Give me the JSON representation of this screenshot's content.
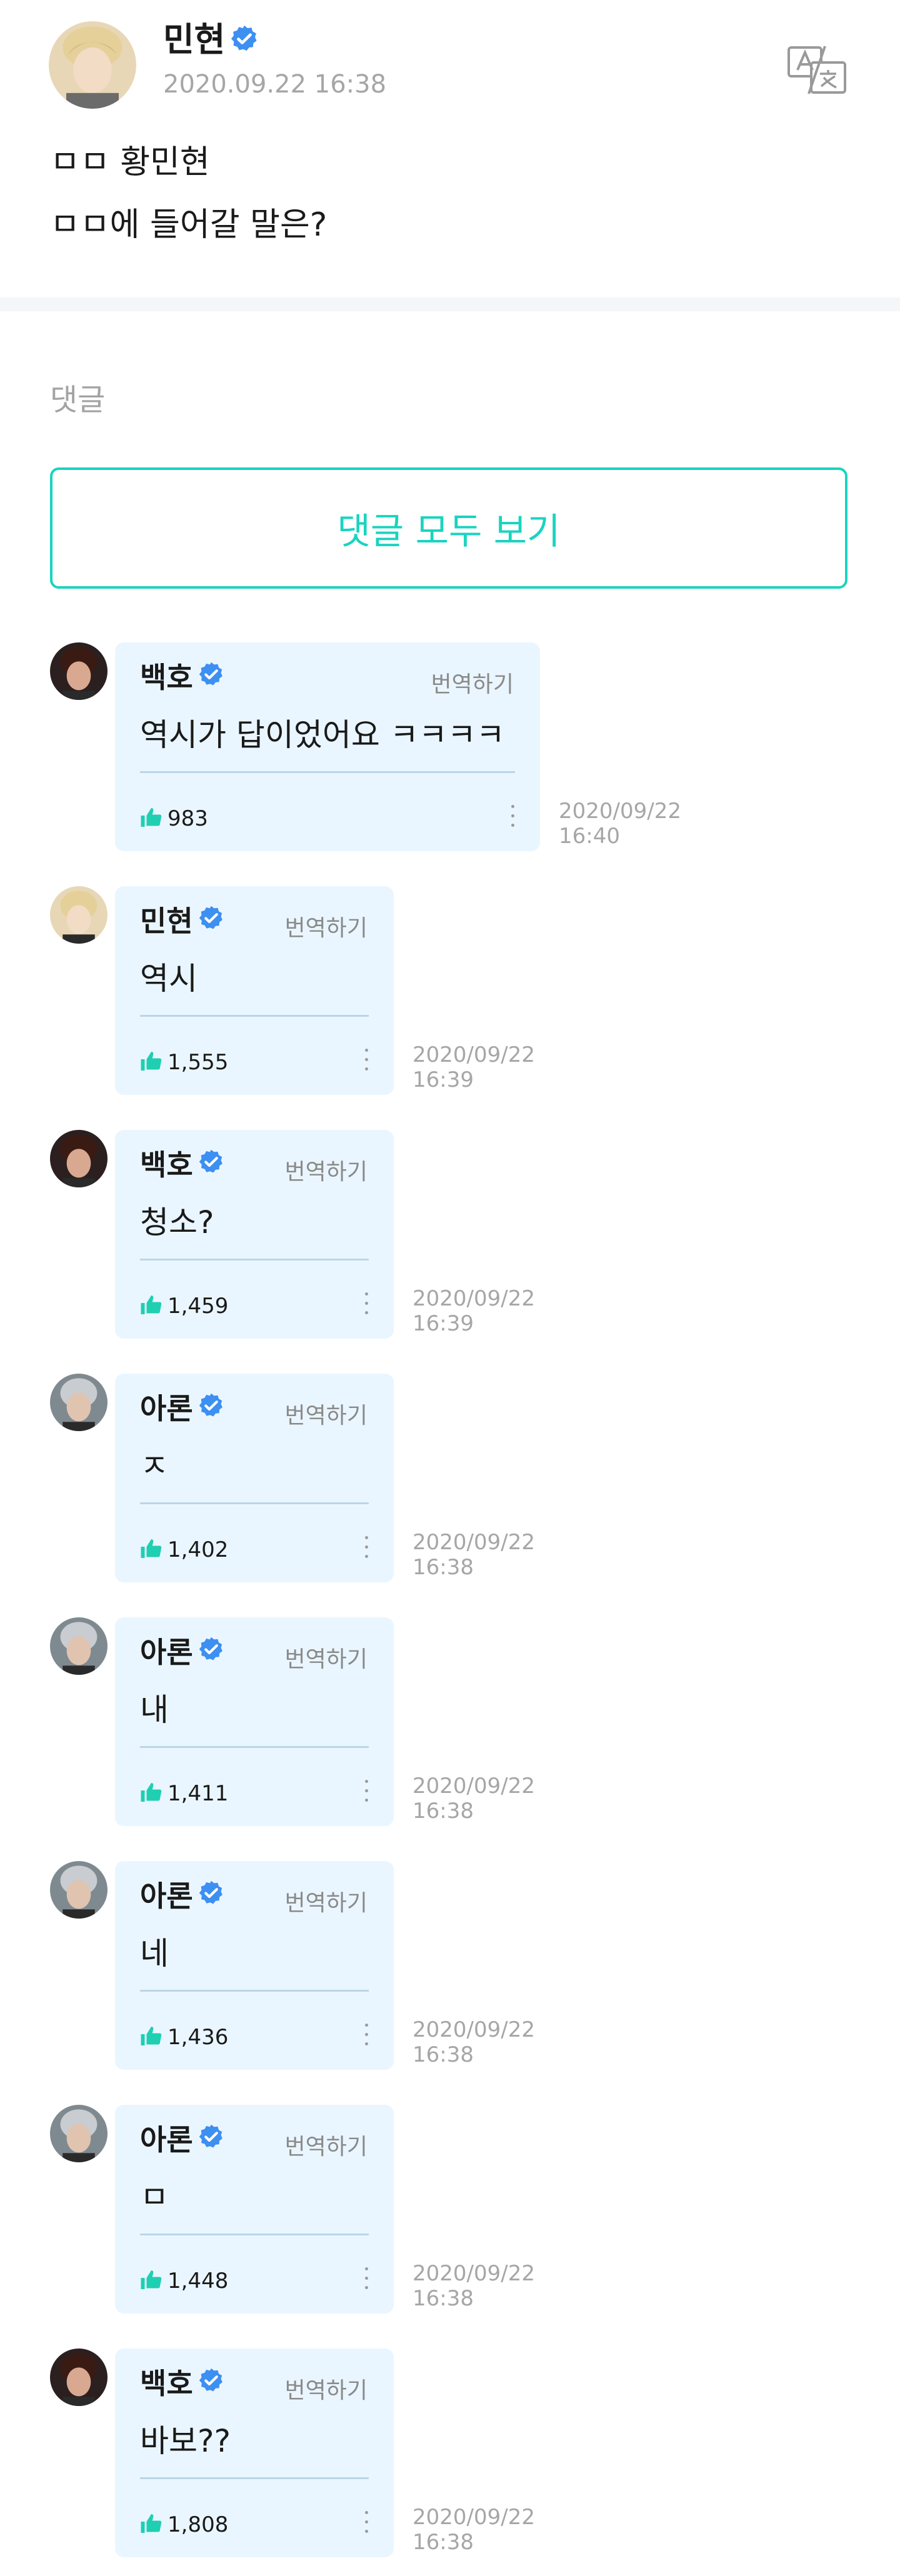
{
  "post": {
    "author": "민현",
    "time": "2020.09.22 16:38",
    "line1": "ㅁㅁ 황민현",
    "line2": "ㅁㅁ에 들어갈 말은?"
  },
  "comments_section": {
    "title": "댓글",
    "view_all_label": "댓글 모두 보기"
  },
  "translate_label": "번역하기",
  "comments": [
    {
      "author": "백호",
      "text": "역시가 답이었어요 ㅋㅋㅋㅋ",
      "likes": "983",
      "date": "2020/09/22",
      "time": "16:40"
    },
    {
      "author": "민현",
      "text": "역시",
      "likes": "1,555",
      "date": "2020/09/22",
      "time": "16:39"
    },
    {
      "author": "백호",
      "text": "청소?",
      "likes": "1,459",
      "date": "2020/09/22",
      "time": "16:39"
    },
    {
      "author": "아론",
      "text": "ㅈ",
      "likes": "1,402",
      "date": "2020/09/22",
      "time": "16:38"
    },
    {
      "author": "아론",
      "text": "내",
      "likes": "1,411",
      "date": "2020/09/22",
      "time": "16:38"
    },
    {
      "author": "아론",
      "text": "네",
      "likes": "1,436",
      "date": "2020/09/22",
      "time": "16:38"
    },
    {
      "author": "아론",
      "text": "ㅁ",
      "likes": "1,448",
      "date": "2020/09/22",
      "time": "16:38"
    },
    {
      "author": "백호",
      "text": "바보??",
      "likes": "1,808",
      "date": "2020/09/22",
      "time": "16:38"
    }
  ],
  "colors": {
    "accent": "#18d4c0",
    "verified": "#3d8ff2",
    "bubble": "#eaf6ff",
    "like": "#1fcfb2"
  },
  "icons": {
    "verified": "verified-badge-icon",
    "translate": "translate-icon",
    "like": "thumbs-up-icon",
    "more": "more-vertical-icon"
  }
}
